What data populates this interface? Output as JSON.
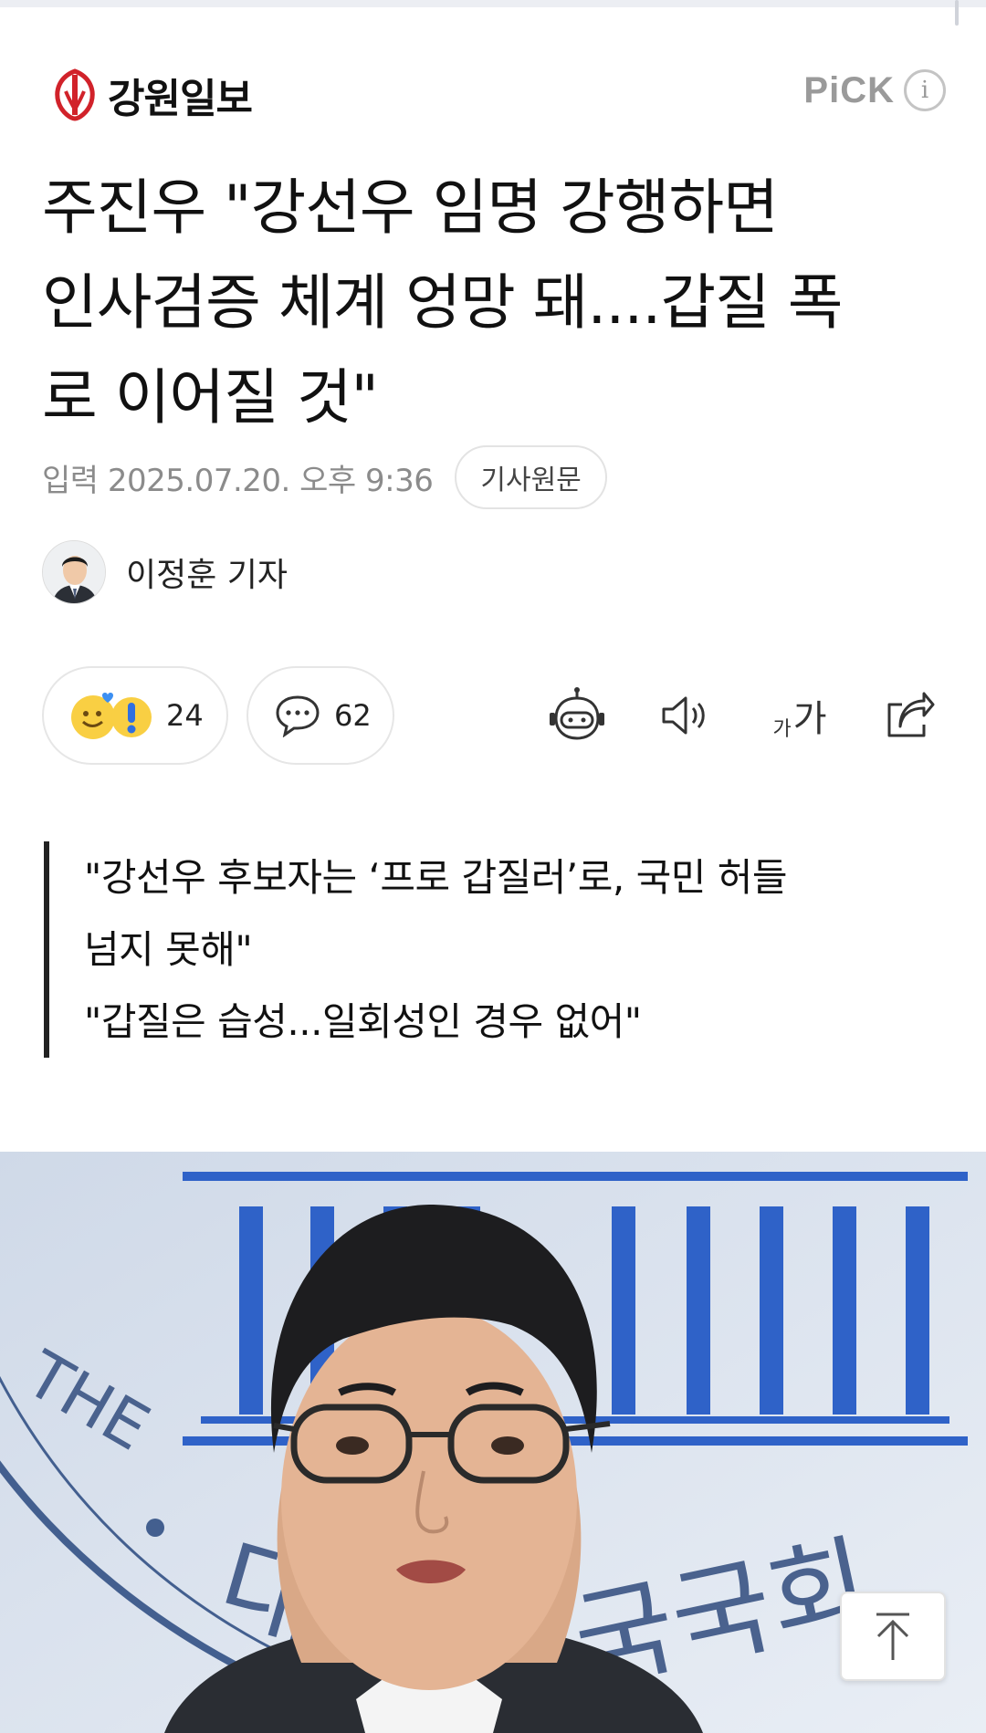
{
  "header": {
    "publisher_name": "강원일보",
    "pick_label": "PiCK",
    "info_glyph": "i",
    "brand_color": "#d1222a"
  },
  "article": {
    "title_lines": [
      "주진우 \"강선우 임명 강행하면",
      "인사검증 체계 엉망 돼....갑질 폭",
      "로 이어질 것\""
    ],
    "date": "입력 2025.07.20. 오후 9:36",
    "original_link_label": "기사원문",
    "author": "이정훈 기자",
    "quote_lines": [
      " \"강선우 후보자는 ‘프로 갑질러’로, 국민 허들",
      "넘지 못해\"",
      "\"갑질은 습성...일회성인 경우 없어\""
    ]
  },
  "actions": {
    "reaction_count": "24",
    "comment_count": "62",
    "font_size_small": "가",
    "font_size_large": "가",
    "icons": [
      "reaction-emoji-icon",
      "comment-bubble-icon",
      "ai-summary-robot-icon",
      "speaker-icon",
      "font-size-icon",
      "share-icon"
    ]
  },
  "photo": {
    "backdrop_text_1": "대",
    "backdrop_text_2": "국국회",
    "backdrop_text_3": "THE"
  },
  "scroll_to_top_icon": "arrow-up-icon"
}
